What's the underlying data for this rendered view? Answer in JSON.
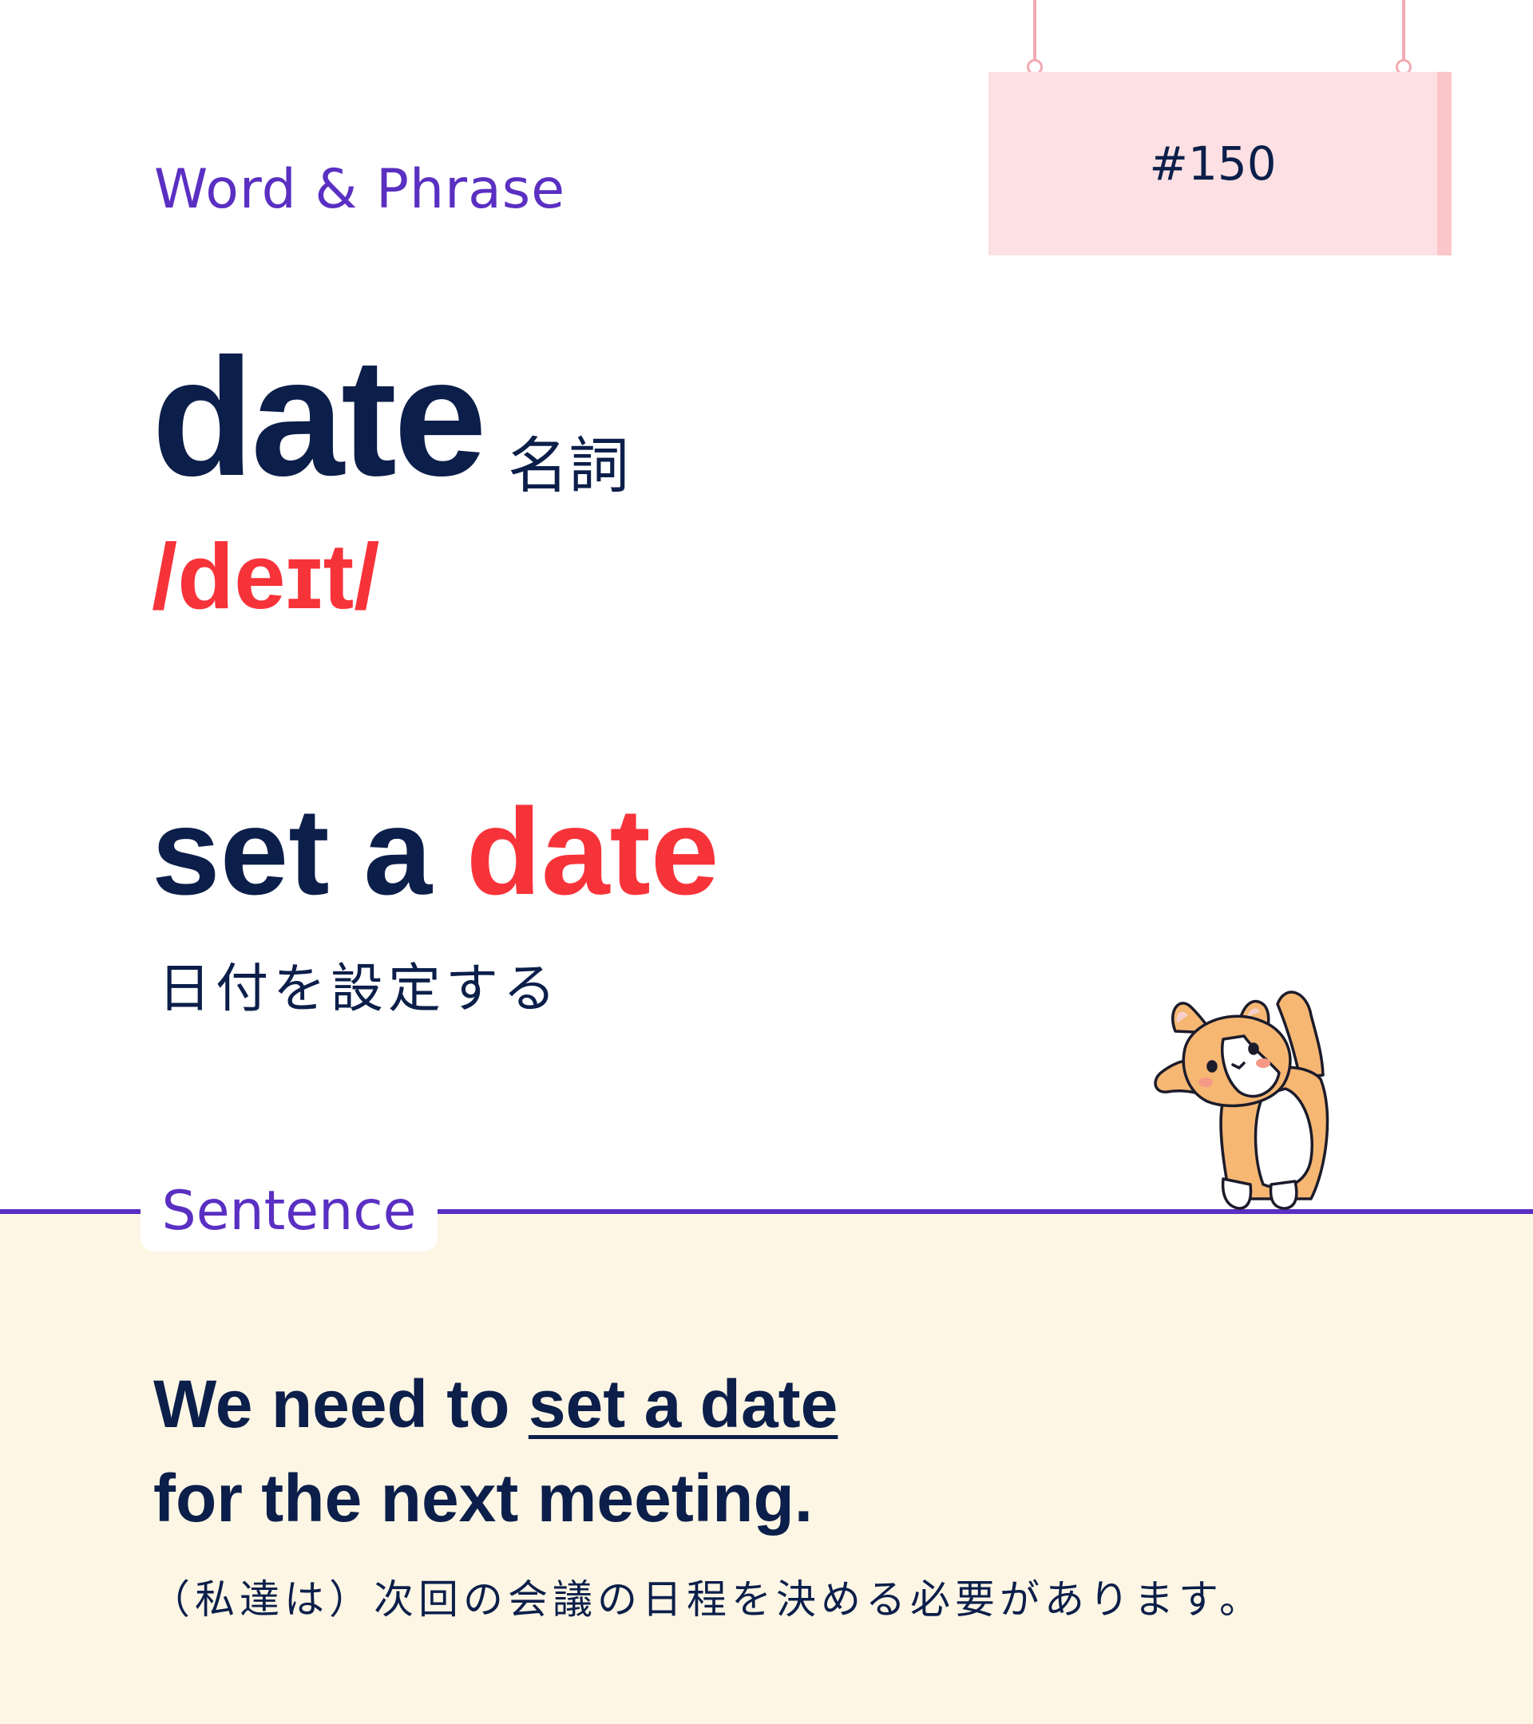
{
  "header": {
    "category": "Word & Phrase",
    "number": "#150"
  },
  "word": {
    "headword": "date",
    "part_of_speech": "名詞",
    "pronunciation": "/deɪt/"
  },
  "phrase": {
    "before": "set a ",
    "highlight": "date",
    "meaning": "日付を設定する"
  },
  "sentence": {
    "label": "Sentence",
    "line1_before": "We need to ",
    "line1_underlined": "set a date",
    "line2": "for the next meeting.",
    "translation": "（私達は）次回の会議の日程を決める必要があります。"
  },
  "colors": {
    "accent_purple": "#5a2fc2",
    "navy_text": "#0c1f4a",
    "highlight_red": "#f7333a",
    "sign_pink": "#fde0e3",
    "sentence_bg": "#fdf6e5"
  },
  "illustration": {
    "icon": "corgi-mascot-icon"
  }
}
